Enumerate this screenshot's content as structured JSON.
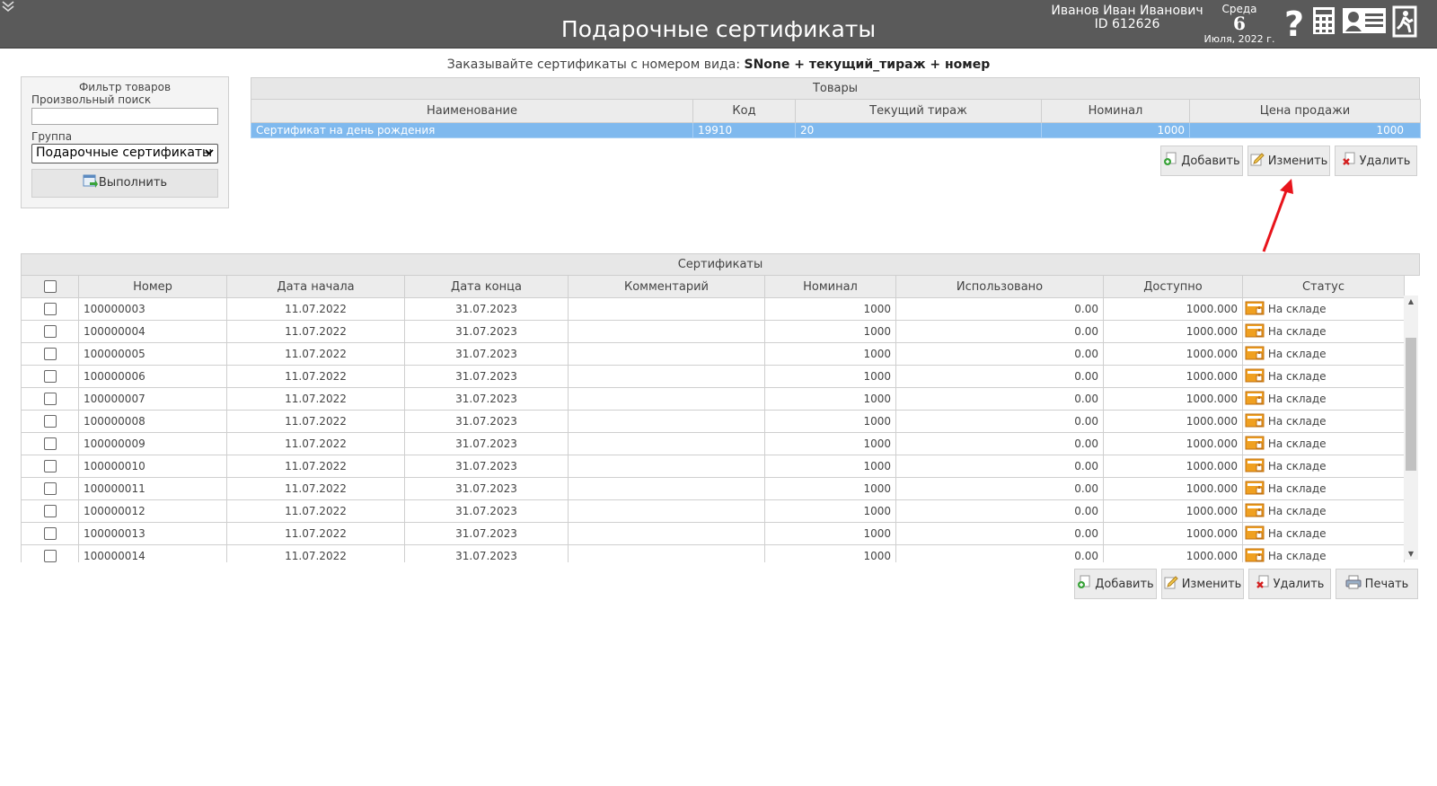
{
  "header": {
    "title": "Подарочные сертификаты",
    "user_name": "Иванов Иван Иванович",
    "user_id": "ID 612626",
    "day_of_week": "Среда",
    "day": "6",
    "month_year": "Июля, 2022 г."
  },
  "hint": {
    "prefix": "Заказывайте сертификаты с номером вида: ",
    "pattern": "SNone + текущий_тираж + номер"
  },
  "filter": {
    "title": "Фильтр товаров",
    "search_label": "Произвольный поиск",
    "search_value": "",
    "group_label": "Группа",
    "group_value": "Подарочные сертификаты",
    "run_label": "Выполнить"
  },
  "products": {
    "caption": "Товары",
    "columns": [
      "Наименование",
      "Код",
      "Текущий тираж",
      "Номинал",
      "Цена продажи"
    ],
    "rows": [
      {
        "name": "Сертификат на день рождения",
        "code": "19910",
        "batch": "20",
        "nominal": "1000",
        "price": "1000"
      }
    ],
    "buttons": {
      "add": "Добавить",
      "edit": "Изменить",
      "delete": "Удалить"
    }
  },
  "certificates": {
    "caption": "Сертификаты",
    "columns": [
      "Номер",
      "Дата начала",
      "Дата конца",
      "Комментарий",
      "Номинал",
      "Использовано",
      "Доступно",
      "Статус"
    ],
    "rows": [
      {
        "number": "100000003",
        "start": "11.07.2022",
        "end": "31.07.2023",
        "comment": "",
        "nominal": "1000",
        "used": "0.00",
        "available": "1000.000",
        "status": "На складе"
      },
      {
        "number": "100000004",
        "start": "11.07.2022",
        "end": "31.07.2023",
        "comment": "",
        "nominal": "1000",
        "used": "0.00",
        "available": "1000.000",
        "status": "На складе"
      },
      {
        "number": "100000005",
        "start": "11.07.2022",
        "end": "31.07.2023",
        "comment": "",
        "nominal": "1000",
        "used": "0.00",
        "available": "1000.000",
        "status": "На складе"
      },
      {
        "number": "100000006",
        "start": "11.07.2022",
        "end": "31.07.2023",
        "comment": "",
        "nominal": "1000",
        "used": "0.00",
        "available": "1000.000",
        "status": "На складе"
      },
      {
        "number": "100000007",
        "start": "11.07.2022",
        "end": "31.07.2023",
        "comment": "",
        "nominal": "1000",
        "used": "0.00",
        "available": "1000.000",
        "status": "На складе"
      },
      {
        "number": "100000008",
        "start": "11.07.2022",
        "end": "31.07.2023",
        "comment": "",
        "nominal": "1000",
        "used": "0.00",
        "available": "1000.000",
        "status": "На складе"
      },
      {
        "number": "100000009",
        "start": "11.07.2022",
        "end": "31.07.2023",
        "comment": "",
        "nominal": "1000",
        "used": "0.00",
        "available": "1000.000",
        "status": "На складе"
      },
      {
        "number": "100000010",
        "start": "11.07.2022",
        "end": "31.07.2023",
        "comment": "",
        "nominal": "1000",
        "used": "0.00",
        "available": "1000.000",
        "status": "На складе"
      },
      {
        "number": "100000011",
        "start": "11.07.2022",
        "end": "31.07.2023",
        "comment": "",
        "nominal": "1000",
        "used": "0.00",
        "available": "1000.000",
        "status": "На складе"
      },
      {
        "number": "100000012",
        "start": "11.07.2022",
        "end": "31.07.2023",
        "comment": "",
        "nominal": "1000",
        "used": "0.00",
        "available": "1000.000",
        "status": "На складе"
      },
      {
        "number": "100000013",
        "start": "11.07.2022",
        "end": "31.07.2023",
        "comment": "",
        "nominal": "1000",
        "used": "0.00",
        "available": "1000.000",
        "status": "На складе"
      },
      {
        "number": "100000014",
        "start": "11.07.2022",
        "end": "31.07.2023",
        "comment": "",
        "nominal": "1000",
        "used": "0.00",
        "available": "1000.000",
        "status": "На складе"
      }
    ],
    "buttons": {
      "add": "Добавить",
      "edit": "Изменить",
      "delete": "Удалить",
      "print": "Печать"
    }
  },
  "colors": {
    "header_bg": "#5a5a5a",
    "selected_row": "#7fb9ee",
    "annotation_arrow": "#e8141b",
    "status_icon": "#f0a020"
  }
}
